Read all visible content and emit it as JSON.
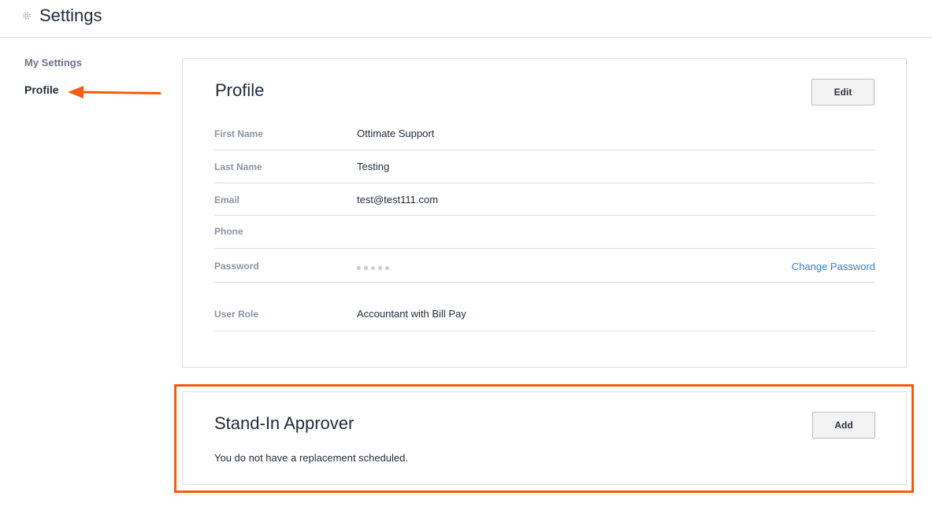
{
  "header": {
    "title": "Settings",
    "icon": "gear-icon"
  },
  "sidebar": {
    "heading": "My Settings",
    "items": [
      {
        "label": "Profile",
        "active": true
      }
    ]
  },
  "profile_card": {
    "title": "Profile",
    "edit_label": "Edit",
    "rows": [
      {
        "label": "First Name",
        "value": "Ottimate Support"
      },
      {
        "label": "Last Name",
        "value": "Testing"
      },
      {
        "label": "Email",
        "value": "test@test111.com"
      },
      {
        "label": "Phone",
        "value": ""
      },
      {
        "label": "Password",
        "value": "",
        "action": "Change Password"
      },
      {
        "label": "User Role",
        "value": "Accountant with Bill Pay"
      }
    ]
  },
  "standin_card": {
    "title": "Stand-In Approver",
    "add_label": "Add",
    "message": "You do not have a replacement scheduled."
  },
  "colors": {
    "annotation": "#f25c0f",
    "link": "#2a86d6",
    "text": "#1f2b3a",
    "muted": "#8b94a3"
  }
}
